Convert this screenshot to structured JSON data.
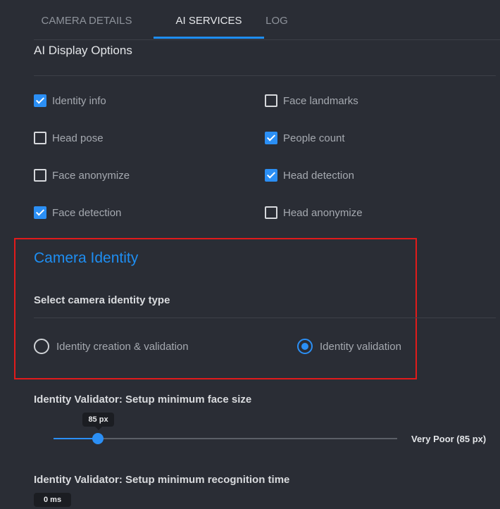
{
  "tabs": [
    {
      "label": "CAMERA DETAILS"
    },
    {
      "label": "AI SERVICES"
    },
    {
      "label": "LOG"
    }
  ],
  "display_options": {
    "title": "AI Display Options",
    "items": [
      {
        "label": "Identity info",
        "checked": true
      },
      {
        "label": "Face landmarks",
        "checked": false
      },
      {
        "label": "Head pose",
        "checked": false
      },
      {
        "label": "People count",
        "checked": true
      },
      {
        "label": "Face anonymize",
        "checked": false
      },
      {
        "label": "Head detection",
        "checked": true
      },
      {
        "label": "Face detection",
        "checked": true
      },
      {
        "label": "Head anonymize",
        "checked": false
      }
    ]
  },
  "camera_identity": {
    "title": "Camera Identity",
    "subtitle": "Select camera identity type",
    "options": [
      {
        "label": "Identity creation & validation",
        "selected": false
      },
      {
        "label": "Identity validation",
        "selected": true
      }
    ]
  },
  "face_size": {
    "label": "Identity Validator: Setup minimum face size",
    "value_label": "85 px",
    "fraction": 0.13,
    "quality": "Very Poor (85 px)"
  },
  "recognition_time": {
    "label": "Identity Validator: Setup minimum recognition time",
    "value_label": "0 ms"
  },
  "colors": {
    "accent": "#2b8ff5",
    "highlight_border": "#e11b1b",
    "background": "#2a2d35"
  }
}
